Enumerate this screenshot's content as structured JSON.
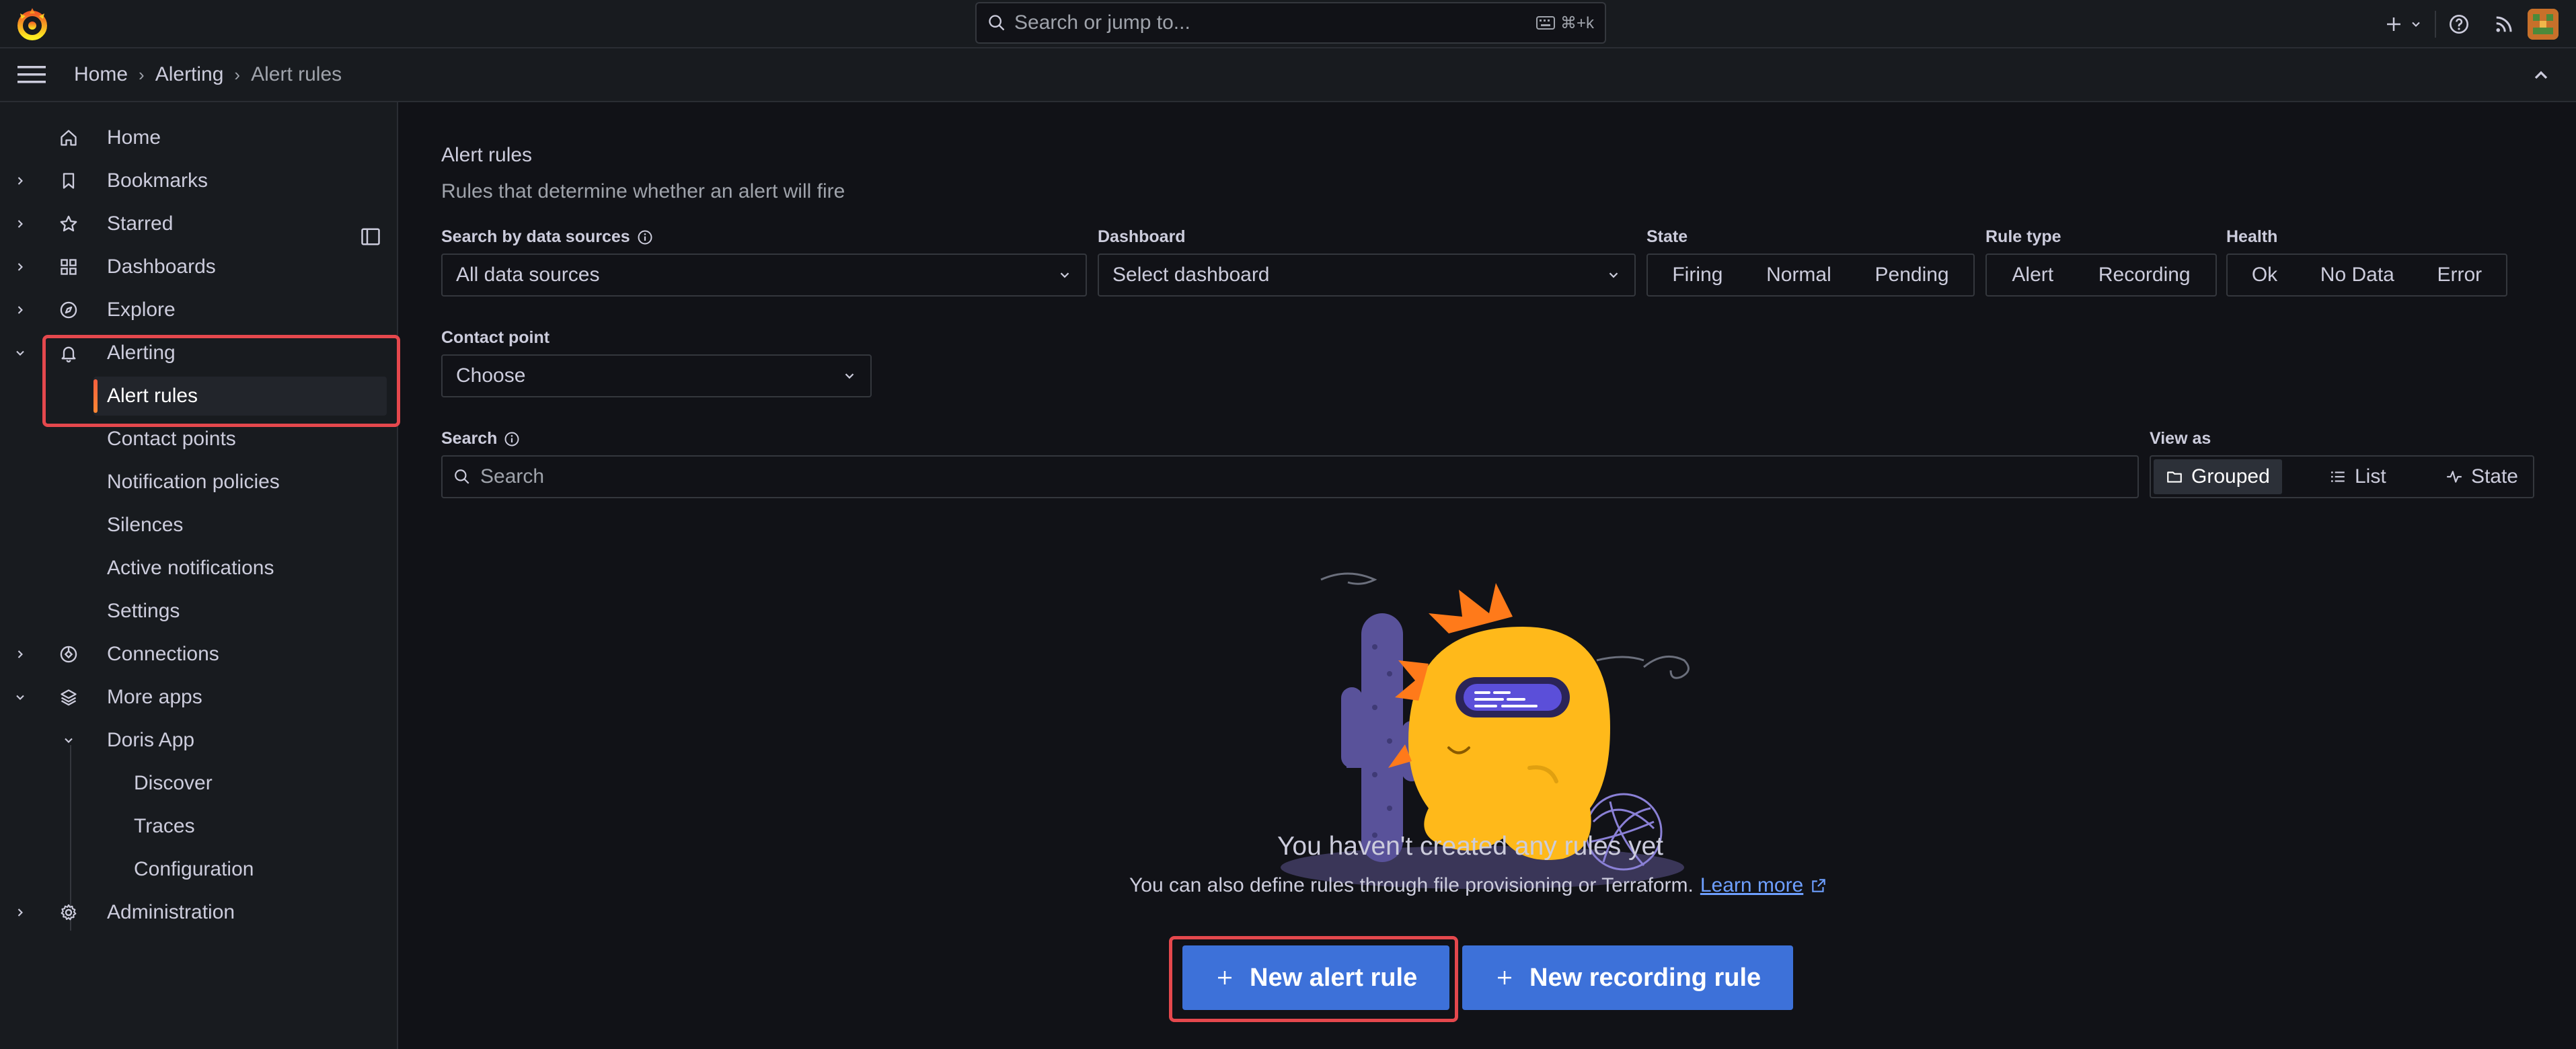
{
  "topbar": {
    "search_placeholder": "Search or jump to...",
    "search_shortcut": "⌘+k",
    "add_label": "+"
  },
  "breadcrumb": [
    "Home",
    "Alerting",
    "Alert rules"
  ],
  "sidebar": {
    "items": [
      {
        "label": "Home",
        "icon": "home-icon"
      },
      {
        "label": "Bookmarks",
        "icon": "bookmark-icon"
      },
      {
        "label": "Starred",
        "icon": "star-icon"
      },
      {
        "label": "Dashboards",
        "icon": "dashboards-icon"
      },
      {
        "label": "Explore",
        "icon": "compass-icon"
      },
      {
        "label": "Alerting",
        "icon": "bell-icon"
      },
      {
        "label": "Alert rules"
      },
      {
        "label": "Contact points"
      },
      {
        "label": "Notification policies"
      },
      {
        "label": "Silences"
      },
      {
        "label": "Active notifications"
      },
      {
        "label": "Settings"
      },
      {
        "label": "Connections",
        "icon": "connections-icon"
      },
      {
        "label": "More apps",
        "icon": "layers-icon"
      },
      {
        "label": "Doris App"
      },
      {
        "label": "Discover"
      },
      {
        "label": "Traces"
      },
      {
        "label": "Configuration"
      },
      {
        "label": "Administration",
        "icon": "gear-icon"
      }
    ]
  },
  "page": {
    "title": "Alert rules",
    "subtitle": "Rules that determine whether an alert will fire"
  },
  "filters": {
    "datasource_label": "Search by data sources",
    "datasource_value": "All data sources",
    "dashboard_label": "Dashboard",
    "dashboard_value": "Select dashboard",
    "state_label": "State",
    "state_options": [
      "Firing",
      "Normal",
      "Pending"
    ],
    "ruletype_label": "Rule type",
    "ruletype_options": [
      "Alert",
      "Recording"
    ],
    "health_label": "Health",
    "health_options": [
      "Ok",
      "No Data",
      "Error"
    ],
    "contact_label": "Contact point",
    "contact_value": "Choose",
    "search_label": "Search",
    "search_placeholder": "Search",
    "viewas_label": "View as",
    "viewas_options": [
      "Grouped",
      "List",
      "State"
    ]
  },
  "empty": {
    "title": "You haven't created any rules yet",
    "subtitle": "You can also define rules through file provisioning or Terraform.",
    "link": "Learn more"
  },
  "actions": {
    "new_alert": "New alert rule",
    "new_recording": "New recording rule"
  },
  "colors": {
    "accent": "#3d71d9",
    "highlight": "#e5484d",
    "active_bar": "#ff8833"
  }
}
